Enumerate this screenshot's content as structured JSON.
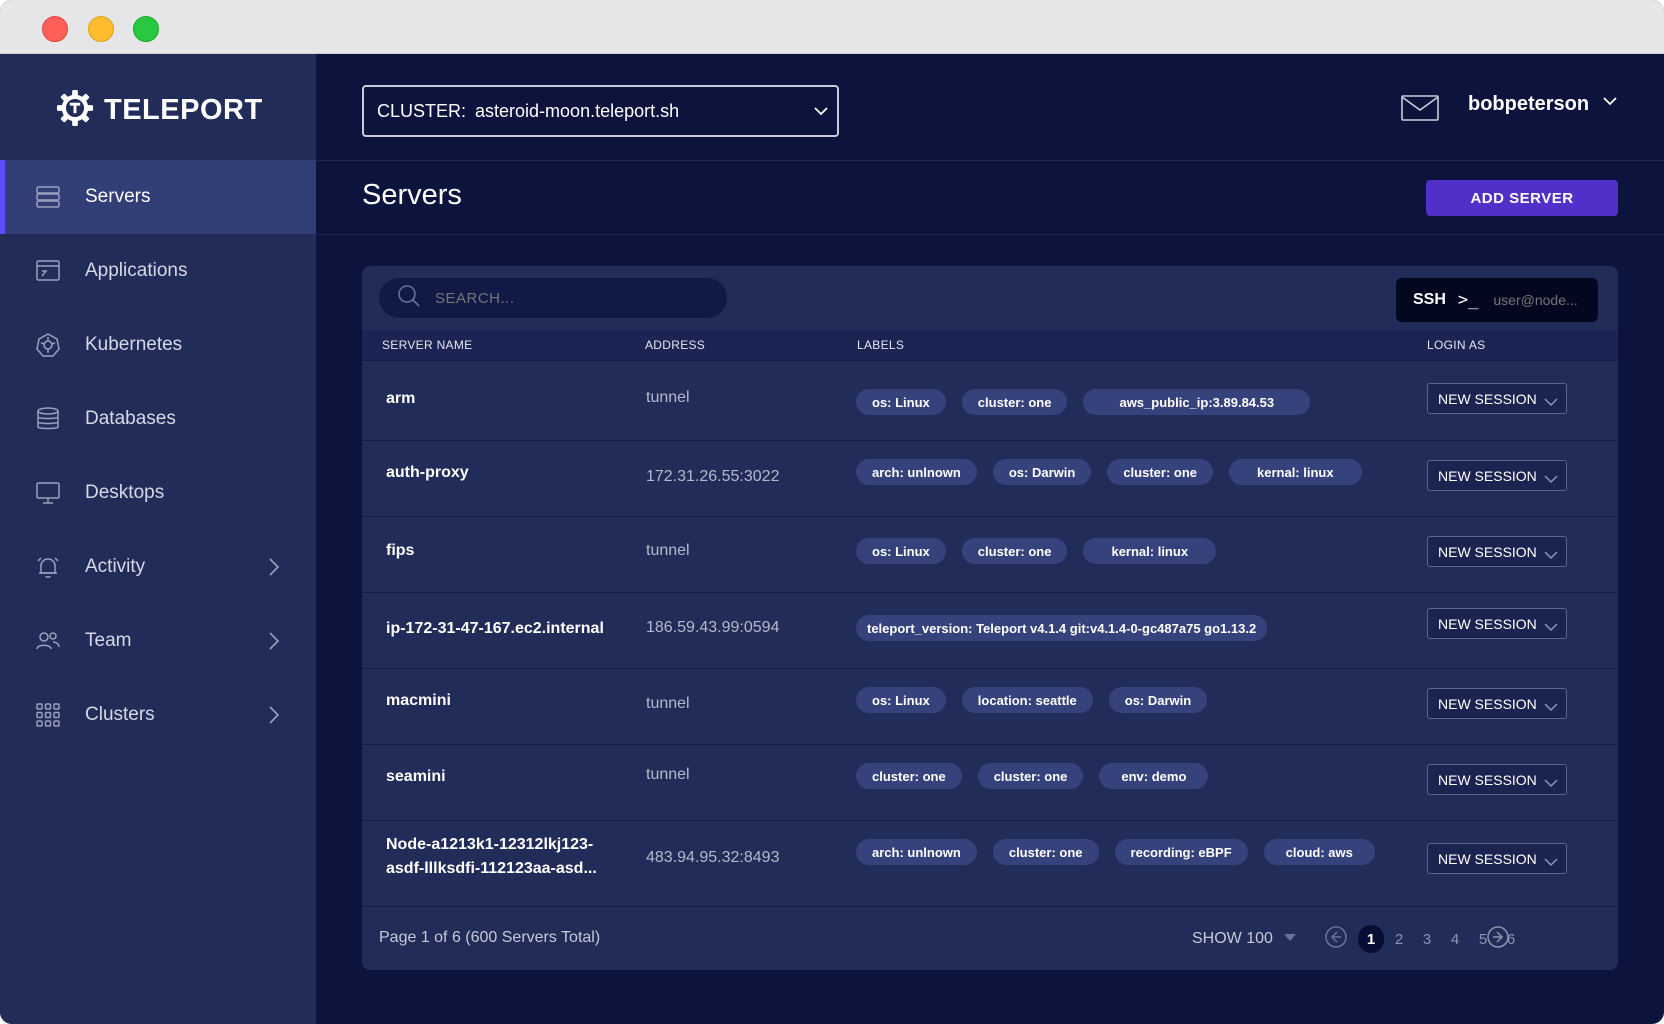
{
  "app": {
    "name": "TELEPORT"
  },
  "sidebar": {
    "items": [
      {
        "label": "Servers"
      },
      {
        "label": "Applications"
      },
      {
        "label": "Kubernetes"
      },
      {
        "label": "Databases"
      },
      {
        "label": "Desktops"
      },
      {
        "label": "Activity"
      },
      {
        "label": "Team"
      },
      {
        "label": "Clusters"
      }
    ]
  },
  "topbar": {
    "cluster_label": "CLUSTER:",
    "cluster_value": "asteroid-moon.teleport.sh",
    "username": "bobpeterson"
  },
  "page": {
    "title": "Servers",
    "add_button": "ADD SERVER"
  },
  "search": {
    "placeholder": "SEARCH..."
  },
  "ssh": {
    "label": "SSH",
    "prompt": ">_",
    "placeholder": "user@node..."
  },
  "table": {
    "columns": [
      "SERVER NAME",
      "ADDRESS",
      "LABELS",
      "LOGIN AS"
    ],
    "session_label": "NEW SESSION",
    "rows": [
      {
        "name": "arm",
        "address": "tunnel",
        "labels": [
          "os: Linux",
          "cluster: one",
          "aws_public_ip:3.89.84.53"
        ]
      },
      {
        "name": "auth-proxy",
        "address": "172.31.26.55:3022",
        "labels": [
          "arch: unlnown",
          "os: Darwin",
          "cluster: one",
          "kernal: linux"
        ]
      },
      {
        "name": "fips",
        "address": "tunnel",
        "labels": [
          "os: Linux",
          "cluster: one",
          "kernal: linux"
        ]
      },
      {
        "name": "ip-172-31-47-167.ec2.internal",
        "address": "186.59.43.99:0594",
        "labels": [
          "teleport_version: Teleport v4.1.4 git:v4.1.4-0-gc487a75 go1.13.2"
        ]
      },
      {
        "name": "macmini",
        "address": "tunnel",
        "labels": [
          "os: Linux",
          "location: seattle",
          "os: Darwin"
        ]
      },
      {
        "name": "seamini",
        "address": "tunnel",
        "labels": [
          "cluster: one",
          "cluster: one",
          "env: demo"
        ]
      },
      {
        "name": "Node-a1213k1-12312lkj123-asdf-lllksdfi-112123aa-asd...",
        "address": "483.94.95.32:8493",
        "labels": [
          "arch: unlnown",
          "cluster: one",
          "recording: eBPF",
          "cloud: aws"
        ]
      }
    ]
  },
  "pagination": {
    "info": "Page 1 of 6  (600 Servers Total)",
    "show": "SHOW 100",
    "pages": [
      "1",
      "2",
      "3",
      "4",
      "5",
      "6"
    ],
    "current": "1"
  },
  "colors": {
    "accent": "#512fc9",
    "background": "#0c143d",
    "sidebar": "#222c59",
    "active_nav": "#323e76"
  },
  "icons": [
    "teleport-logo-icon",
    "servers-icon",
    "applications-icon",
    "kubernetes-icon",
    "databases-icon",
    "desktops-icon",
    "activity-bell-icon",
    "team-icon",
    "clusters-grid-icon",
    "chevron-right-icon",
    "chevron-down-icon",
    "mail-icon",
    "search-icon",
    "arrow-left-icon",
    "arrow-right-icon"
  ]
}
